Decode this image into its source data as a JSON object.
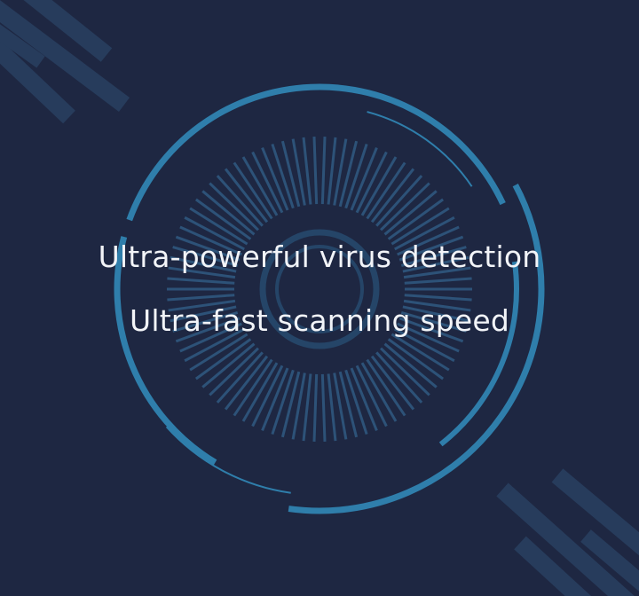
{
  "headline": {
    "line1": "Ultra-powerful virus detection",
    "line2": "Ultra-fast scanning speed"
  },
  "colors": {
    "background": "#1e2742",
    "ring": "#2f7eab",
    "ring_dim": "#2b6f9a",
    "ticks": "#34658f",
    "stripes": "#273c5c",
    "text": "#f2f4f8"
  },
  "icons": {
    "scanner": "radar-scanner-icon"
  }
}
